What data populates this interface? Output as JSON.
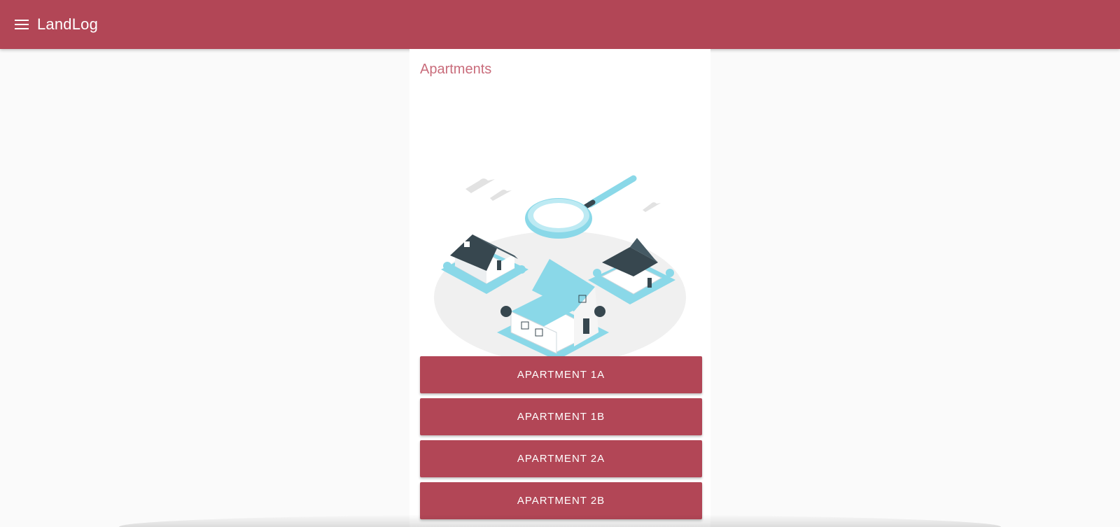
{
  "app_bar": {
    "title": "LandLog",
    "menu_icon": "menu-icon",
    "color": "#b24656"
  },
  "page": {
    "section_title": "Apartments",
    "illustration": "houses-magnifier-illustration",
    "apartments": [
      {
        "label": "APARTMENT 1A"
      },
      {
        "label": "APARTMENT 1B"
      },
      {
        "label": "APARTMENT 2A"
      },
      {
        "label": "APARTMENT 2B"
      }
    ]
  },
  "colors": {
    "accent": "#b24656",
    "title_pink": "#c96c7b",
    "illustration_cyan": "#8ad8e8",
    "illustration_dark": "#37474f"
  }
}
